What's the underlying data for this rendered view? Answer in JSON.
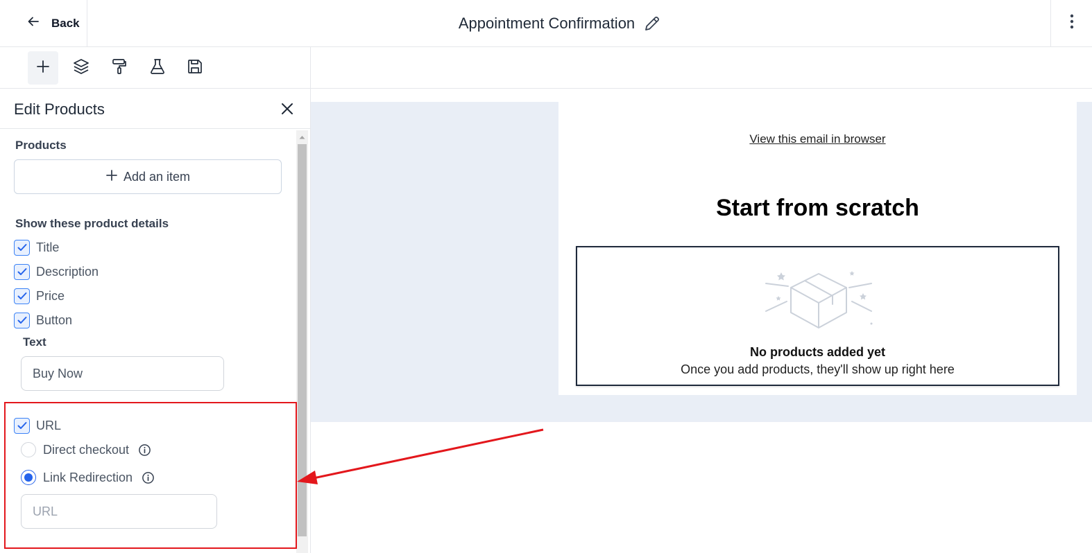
{
  "topbar": {
    "back_label": "Back",
    "title": "Appointment Confirmation"
  },
  "toolbar": {
    "tools": [
      "plus-icon",
      "layers-icon",
      "paint-roller-icon",
      "flask-icon",
      "save-icon"
    ],
    "active_tool": "plus-icon"
  },
  "sidebar": {
    "title": "Edit Products",
    "products_label": "Products",
    "add_item_label": "Add an item",
    "details_label": "Show these product details",
    "details": [
      {
        "label": "Title",
        "checked": true
      },
      {
        "label": "Description",
        "checked": true
      },
      {
        "label": "Price",
        "checked": true
      },
      {
        "label": "Button",
        "checked": true
      }
    ],
    "button_text_label": "Text",
    "button_text_value": "Buy Now",
    "url_checkbox_label": "URL",
    "url_checked": true,
    "url_options": [
      {
        "label": "Direct checkout",
        "selected": false
      },
      {
        "label": "Link Redirection",
        "selected": true
      }
    ],
    "url_input_placeholder": "URL"
  },
  "email": {
    "view_in_browser": "View this email in browser",
    "heading": "Start from scratch",
    "empty_title": "No products added yet",
    "empty_subtitle": "Once you add products, they'll show up right here"
  },
  "colors": {
    "accent": "#2563eb",
    "highlight": "#e3171c",
    "canvas_bg": "#e9eef6"
  }
}
